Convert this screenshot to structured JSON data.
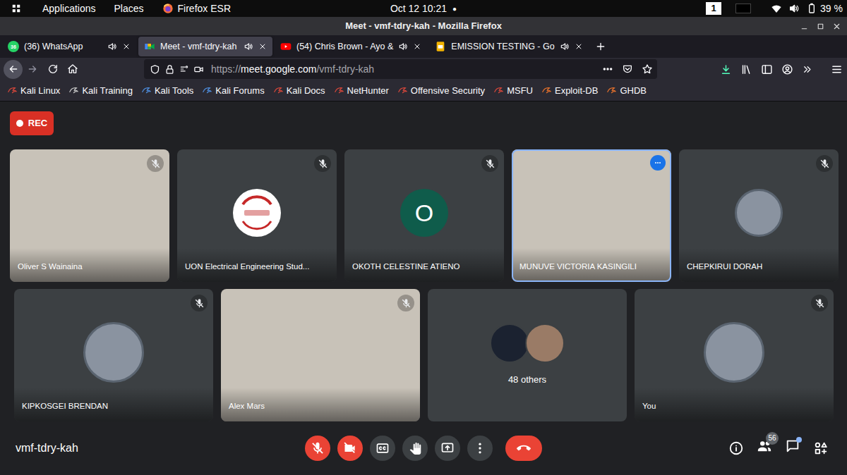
{
  "desktop_bar": {
    "applications": "Applications",
    "places": "Places",
    "app": "Firefox ESR",
    "clock": "Oct 12 10:21",
    "clock_dot": "●",
    "workspace": "1",
    "battery": "39 %"
  },
  "window": {
    "title": "Meet - vmf-tdry-kah - Mozilla Firefox"
  },
  "tabs": [
    {
      "label": "(36) WhatsApp",
      "kind": "whatsapp",
      "badge": "36",
      "selected": false,
      "audio": false
    },
    {
      "label": "Meet - vmf-tdry-kah",
      "kind": "meet",
      "selected": true,
      "audio": true
    },
    {
      "label": "(54) Chris Brown - Ayo &",
      "kind": "youtube",
      "selected": false,
      "audio": false
    },
    {
      "label": "EMISSION TESTING - Go",
      "kind": "slides",
      "selected": false,
      "audio": false
    }
  ],
  "address_bar": {
    "scheme": "https://",
    "host": "meet.google.com",
    "path": "/vmf-tdry-kah"
  },
  "bookmarks": [
    {
      "label": "Kali Linux",
      "color": "#d9473b"
    },
    {
      "label": "Kali Training",
      "color": "#c9c9c9"
    },
    {
      "label": "Kali Tools",
      "color": "#4f8fe0"
    },
    {
      "label": "Kali Forums",
      "color": "#4f8fe0"
    },
    {
      "label": "Kali Docs",
      "color": "#d9473b"
    },
    {
      "label": "NetHunter",
      "color": "#d9473b"
    },
    {
      "label": "Offensive Security",
      "color": "#d9473b"
    },
    {
      "label": "MSFU",
      "color": "#d9473b"
    },
    {
      "label": "Exploit-DB",
      "color": "#e8722c"
    },
    {
      "label": "GHDB",
      "color": "#e8722c"
    }
  ],
  "meeting": {
    "recording": "REC",
    "code": "vmf-tdry-kah",
    "participant_count": "56",
    "chat_unread": true
  },
  "tile_rows": [
    [
      {
        "name": "Oliver S Wainaina",
        "kind": "video",
        "muted": true,
        "speaking": false
      },
      {
        "name": "UON Electrical Engineering Stud...",
        "kind": "logo",
        "muted": true,
        "speaking": false
      },
      {
        "name": "OKOTH CELESTINE ATIENO",
        "kind": "letter",
        "letter": "O",
        "color": "#0f5c4b",
        "muted": true,
        "speaking": false
      },
      {
        "name": "MUNUVE VICTORIA KASINGILI",
        "kind": "video",
        "muted": false,
        "speaking": true
      },
      {
        "name": "CHEPKIRUI DORAH",
        "kind": "photo",
        "muted": true,
        "speaking": false
      }
    ],
    [
      {
        "name": "KIPKOSGEI BRENDAN",
        "kind": "photo",
        "muted": true,
        "speaking": false
      },
      {
        "name": "Alex Mars",
        "kind": "video",
        "muted": true,
        "speaking": false
      },
      {
        "name": "48 others",
        "kind": "others"
      },
      {
        "name": "You",
        "kind": "photo",
        "muted": true,
        "speaking": false
      }
    ]
  ],
  "controls": [
    {
      "kind": "mic",
      "on": false
    },
    {
      "kind": "camera",
      "on": false
    },
    {
      "kind": "captions",
      "on": false
    },
    {
      "kind": "hand",
      "on": false
    },
    {
      "kind": "present",
      "on": false
    },
    {
      "kind": "more"
    },
    {
      "kind": "leave"
    }
  ]
}
